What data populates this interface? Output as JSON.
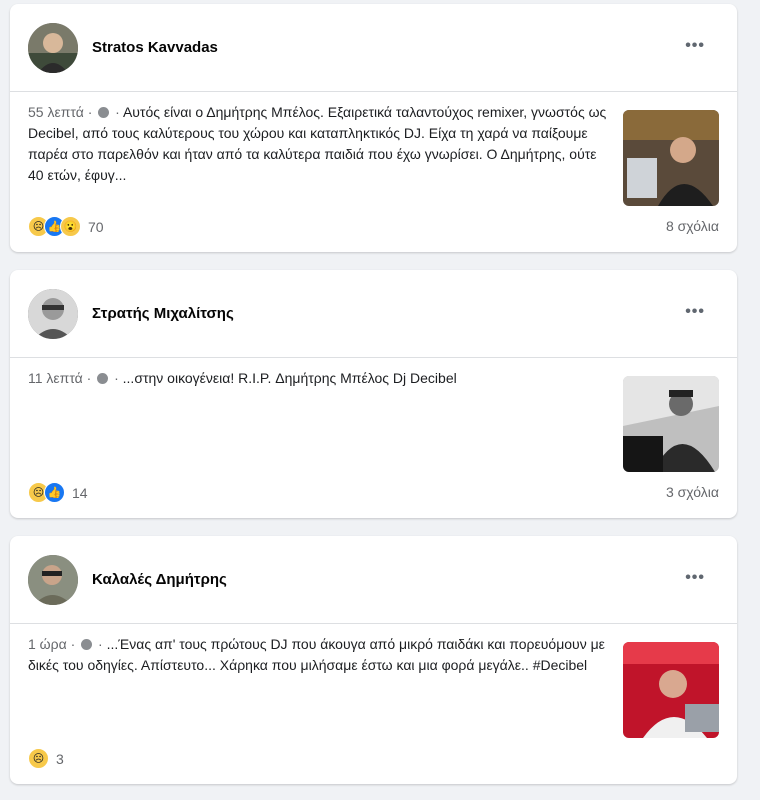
{
  "posts": [
    {
      "author": "Stratos Kavvadas",
      "time": "55 λεπτά",
      "text": "Αυτός είναι ο Δημήτρης Μπέλος. Εξαιρετικά ταλαντούχος remixer, γνωστός ως Decibel, από τους καλύτερους του χώρου και καταπληκτικός DJ. Είχα τη χαρά να παίξουμε παρέα στο παρελθόν και ήταν από τα καλύτερα παιδιά που έχω γνωρίσει. Ο Δημήτρης, ούτε 40 ετών, έφυγ...",
      "reaction_count": "70",
      "comments": "8 σχόλια",
      "reactions": [
        "sad-reaction-icon",
        "like-reaction-icon",
        "wow-reaction-icon"
      ]
    },
    {
      "author": "Στρατής Μιχαλίτσης",
      "time": "11 λεπτά",
      "text": "...στην οικογένεια! R.I.P. Δημήτρης Μπέλος Dj Decibel",
      "reaction_count": "14",
      "comments": "3 σχόλια",
      "reactions": [
        "sad-reaction-icon",
        "like-reaction-icon"
      ]
    },
    {
      "author": "Καλαλές Δημήτρης",
      "time": "1 ώρα",
      "text": "...Ένας απ' τους πρώτους DJ που άκουγα από μικρό παιδάκι και πορευόμουν με δικές του οδηγίες. Απίστευτο... Χάρηκα που μιλήσαμε έστω και μια φορά μεγάλε.. #Decibel",
      "reaction_count": "3",
      "comments": "",
      "reactions": [
        "sad-reaction-icon"
      ]
    }
  ],
  "ui": {
    "more_label": "•••",
    "separator": "·",
    "colors": {
      "background": "#f0f2f5",
      "card": "#ffffff",
      "meta": "#65676b",
      "like": "#1877f2"
    }
  }
}
